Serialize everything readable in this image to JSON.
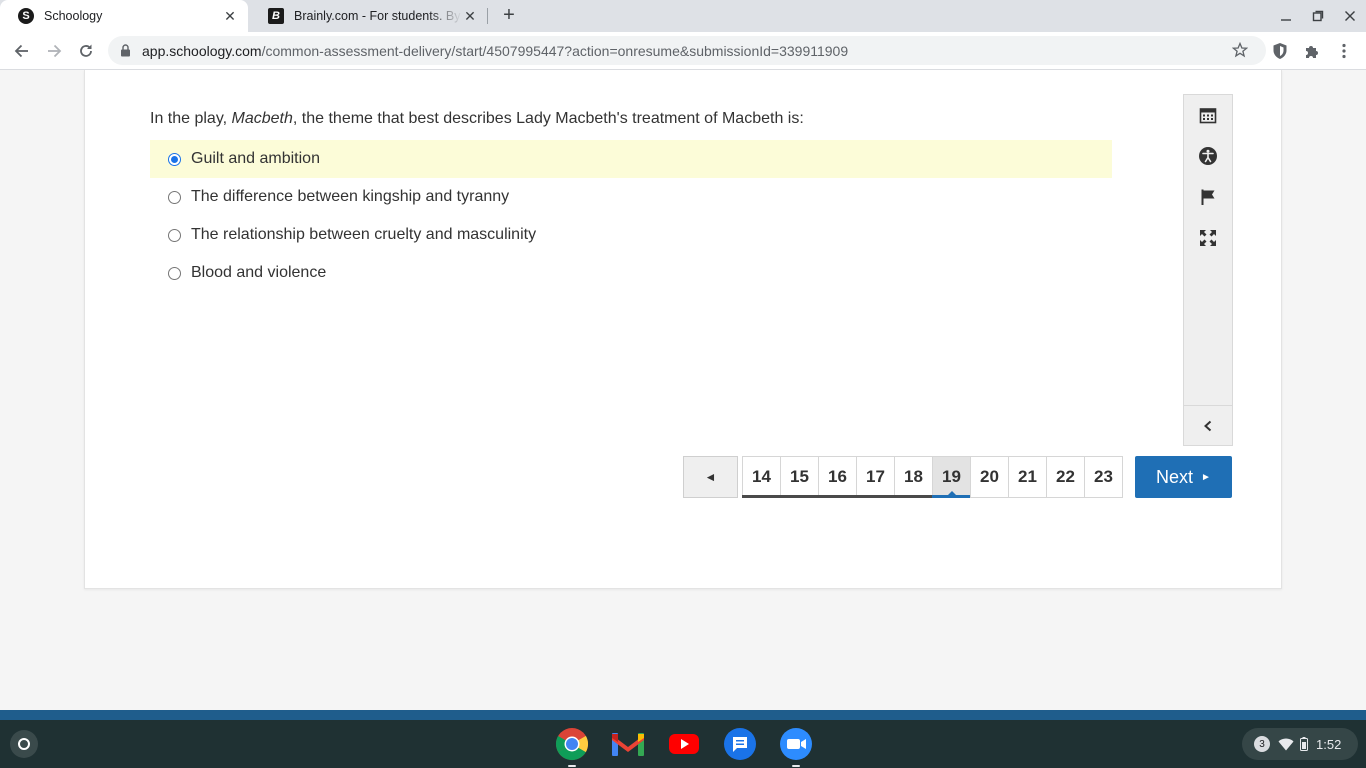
{
  "browser": {
    "tabs": [
      {
        "title": "Schoology",
        "favicon": "S"
      },
      {
        "title": "Brainly.com - For students. By students.",
        "favicon": "B"
      }
    ],
    "url_host": "app.schoology.com",
    "url_path": "/common-assessment-delivery/start/4507995447?action=onresume&submissionId=339911909"
  },
  "question": {
    "prefix": "In the play, ",
    "work_title": "Macbeth",
    "suffix": ", the theme that best describes Lady Macbeth's treatment of Macbeth is:",
    "options": [
      {
        "label": "Guilt and ambition",
        "selected": true
      },
      {
        "label": "The difference between kingship and tyranny",
        "selected": false
      },
      {
        "label": "The relationship between cruelty and masculinity",
        "selected": false
      },
      {
        "label": "Blood and violence",
        "selected": false
      }
    ]
  },
  "tools": [
    "calendar-icon",
    "accessibility-icon",
    "flag-icon",
    "fullscreen-icon",
    "collapse-icon"
  ],
  "pager": {
    "prev_symbol": "◄",
    "pages": [
      {
        "num": "14",
        "state": "answered"
      },
      {
        "num": "15",
        "state": "answered"
      },
      {
        "num": "16",
        "state": "answered"
      },
      {
        "num": "17",
        "state": "answered"
      },
      {
        "num": "18",
        "state": "answered"
      },
      {
        "num": "19",
        "state": "current"
      },
      {
        "num": "20",
        "state": "unanswered"
      },
      {
        "num": "21",
        "state": "unanswered"
      },
      {
        "num": "22",
        "state": "unanswered"
      },
      {
        "num": "23",
        "state": "unanswered"
      }
    ],
    "next_label": "Next",
    "next_symbol": "►"
  },
  "shelf": {
    "apps": [
      "chrome-icon",
      "gmail-icon",
      "youtube-icon",
      "messages-icon",
      "zoom-icon"
    ],
    "notification_count": "3",
    "time": "1:52"
  },
  "colors": {
    "accent": "#1f6fb5",
    "selected_highlight": "#fcfcd8",
    "shelf": "#1f3133"
  }
}
